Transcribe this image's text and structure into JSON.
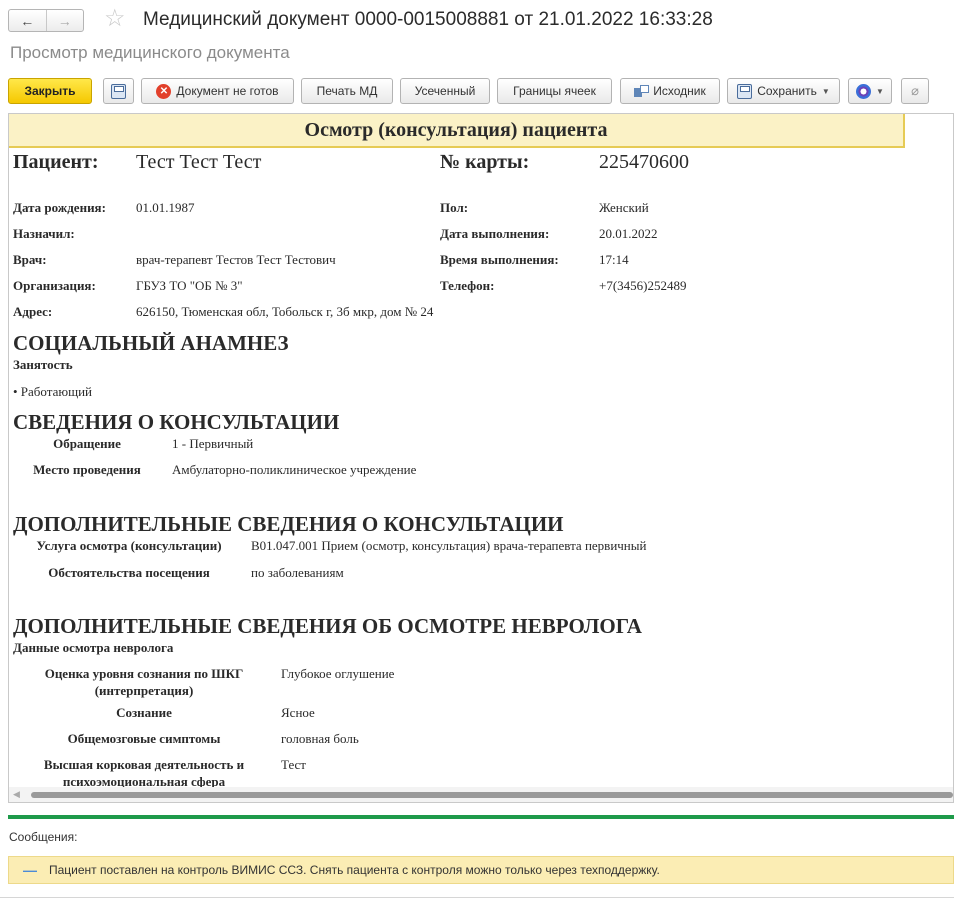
{
  "window": {
    "title": "Медицинский документ 0000-0015008881 от 21.01.2022 16:33:28",
    "subtitle": "Просмотр медицинского документа"
  },
  "nav": {
    "back": "←",
    "forward": "→",
    "star": "☆"
  },
  "toolbar": {
    "close": "Закрыть",
    "not_ready": "Документ не готов",
    "print": "Печать МД",
    "truncated": "Усеченный",
    "borders": "Границы ячеек",
    "source": "Исходник",
    "save": "Сохранить"
  },
  "document": {
    "header": "Осмотр (консультация) пациента",
    "patient_label": "Пациент:",
    "patient_value": "Тест Тест Тест",
    "card_label": "№ карты:",
    "card_value": "225470600",
    "fields_left": [
      {
        "label": "Дата рождения:",
        "value": "01.01.1987"
      },
      {
        "label": "Назначил:",
        "value": ""
      },
      {
        "label": "Врач:",
        "value": "врач-терапевт Тестов Тест Тестович"
      },
      {
        "label": "Организация:",
        "value": "ГБУЗ ТО \"ОБ № 3\""
      },
      {
        "label": "Адрес:",
        "value": "626150, Тюменская обл, Тобольск г, 3б мкр, дом № 24"
      }
    ],
    "fields_right": [
      {
        "label": "Пол:",
        "value": "Женский"
      },
      {
        "label": "Дата выполнения:",
        "value": "20.01.2022"
      },
      {
        "label": "Время выполнения:",
        "value": "17:14"
      },
      {
        "label": "Телефон:",
        "value": "+7(3456)252489"
      }
    ],
    "social": {
      "heading": "СОЦИАЛЬНЫЙ АНАМНЕЗ",
      "sub": "Занятость",
      "item": "• Работающий"
    },
    "consult": {
      "heading": "СВЕДЕНИЯ О КОНСУЛЬТАЦИИ",
      "rows": [
        {
          "label": "Обращение",
          "value": "1 - Первичный"
        },
        {
          "label": "Место проведения",
          "value": "Амбулаторно-поликлиническое учреждение"
        }
      ]
    },
    "extra": {
      "heading": "ДОПОЛНИТЕЛЬНЫЕ СВЕДЕНИЯ О КОНСУЛЬТАЦИИ",
      "rows": [
        {
          "label": "Услуга осмотра (консультации)",
          "value": "B01.047.001 Прием (осмотр, консультация) врача-терапевта первичный"
        },
        {
          "label": "Обстоятельства посещения",
          "value": "по заболеваниям"
        }
      ]
    },
    "neuro": {
      "heading": "ДОПОЛНИТЕЛЬНЫЕ СВЕДЕНИЯ ОБ ОСМОТРЕ НЕВРОЛОГА",
      "sub": "Данные осмотра невролога",
      "rows": [
        {
          "label1": "Оценка уровня сознания по ШКГ",
          "label2": "(интерпретация)",
          "value": "Глубокое оглушение"
        },
        {
          "label1": "Сознание",
          "label2": "",
          "value": "Ясное"
        },
        {
          "label1": "Общемозговые симптомы",
          "label2": "",
          "value": "головная боль"
        },
        {
          "label1": "Высшая корковая деятельность и",
          "label2": "психоэмоциональная сфера",
          "value": "Тест"
        }
      ]
    }
  },
  "messages": {
    "title": "Сообщения:",
    "dash": "—",
    "text": "Пациент поставлен на контроль ВИМИС ССЗ. Снять пациента с контроля можно только через техподдержку."
  }
}
